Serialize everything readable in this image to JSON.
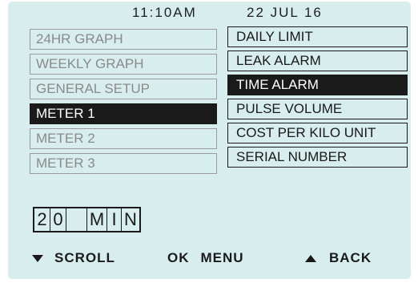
{
  "status": {
    "time": "11:10AM",
    "date": "22  JUL  16"
  },
  "left_menu": [
    {
      "label": "24HR GRAPH",
      "active": false
    },
    {
      "label": "WEEKLY GRAPH",
      "active": false
    },
    {
      "label": "GENERAL SETUP",
      "active": false
    },
    {
      "label": "METER 1",
      "active": true
    },
    {
      "label": "METER 2",
      "active": false
    },
    {
      "label": "METER 3",
      "active": false
    }
  ],
  "right_menu": [
    {
      "label": "DAILY LIMIT",
      "active": false
    },
    {
      "label": "LEAK ALARM",
      "active": false
    },
    {
      "label": "TIME ALARM",
      "active": true
    },
    {
      "label": "PULSE VOLUME",
      "active": false
    },
    {
      "label": "COST PER KILO UNIT",
      "active": false
    },
    {
      "label": "SERIAL NUMBER",
      "active": false
    }
  ],
  "value_display": {
    "chars": [
      "2",
      "0",
      "",
      "M",
      "I",
      "N"
    ]
  },
  "footer": {
    "scroll_label": "SCROLL",
    "ok_label": "OK",
    "menu_label": "MENU",
    "back_label": "BACK"
  },
  "icons": {
    "scroll": "arrow-down-icon",
    "back": "arrow-up-icon"
  },
  "colors": {
    "screen_background": "#d8eeee",
    "highlight": "#1a1a1a",
    "inactive_text": "#8a8a8a"
  }
}
